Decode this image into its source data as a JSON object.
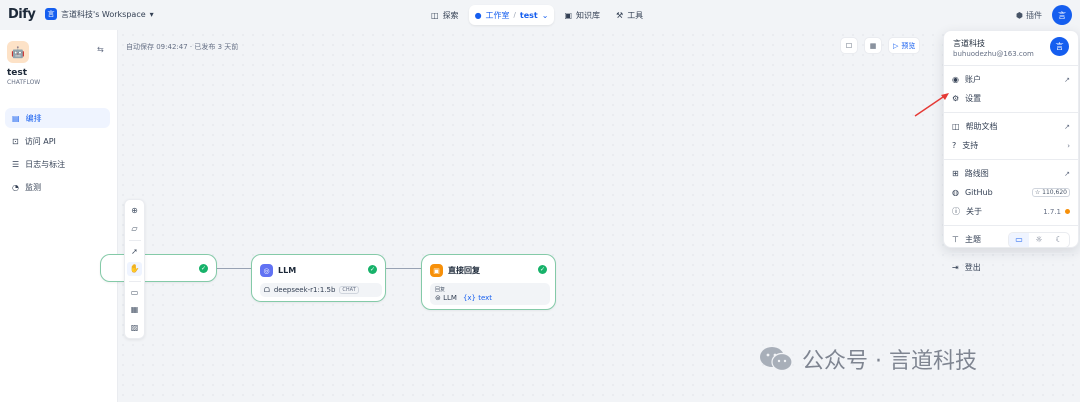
{
  "topbar": {
    "logo": "Dify",
    "workspace_avatar": "言",
    "workspace": "言道科技's Workspace",
    "nav": {
      "explore": "探索",
      "studio": "工作室",
      "app": "test",
      "knowledge": "知识库",
      "tools": "工具"
    },
    "plugin": "插件",
    "avatar": "言"
  },
  "sidebar": {
    "app_name": "test",
    "app_type": "CHATFLOW",
    "items": [
      {
        "label": "编排",
        "icon": "layout-icon"
      },
      {
        "label": "访问 API",
        "icon": "terminal-icon"
      },
      {
        "label": "日志与标注",
        "icon": "file-list-icon"
      },
      {
        "label": "监测",
        "icon": "monitor-icon"
      }
    ]
  },
  "canvas": {
    "autosave": "自动保存 09:42:47 · 已发布 3 天前",
    "preview": "预览",
    "nodes": {
      "llm": {
        "title": "LLM",
        "model": "deepseek-r1:1.5b",
        "tag": "CHAT"
      },
      "answer": {
        "title": "直接回复",
        "label": "回复",
        "var_source": "LLM",
        "var_name": "{x} text"
      }
    }
  },
  "dropdown": {
    "name": "言道科技",
    "email": "buhuodezhu@163.com",
    "avatar": "言",
    "items": {
      "account": "账户",
      "settings": "设置",
      "help": "帮助文档",
      "support": "支持",
      "roadmap": "路线图",
      "github": "GitHub",
      "github_stars": "☆ 110,620",
      "about": "关于",
      "version": "1.7.1",
      "theme": "主题",
      "logout": "登出"
    }
  },
  "watermark": "公众号 · 言道科技",
  "colors": {
    "accent": "#155eef",
    "success": "#17b26a",
    "node_border": "#84caa8",
    "arrow": "#e53935"
  }
}
